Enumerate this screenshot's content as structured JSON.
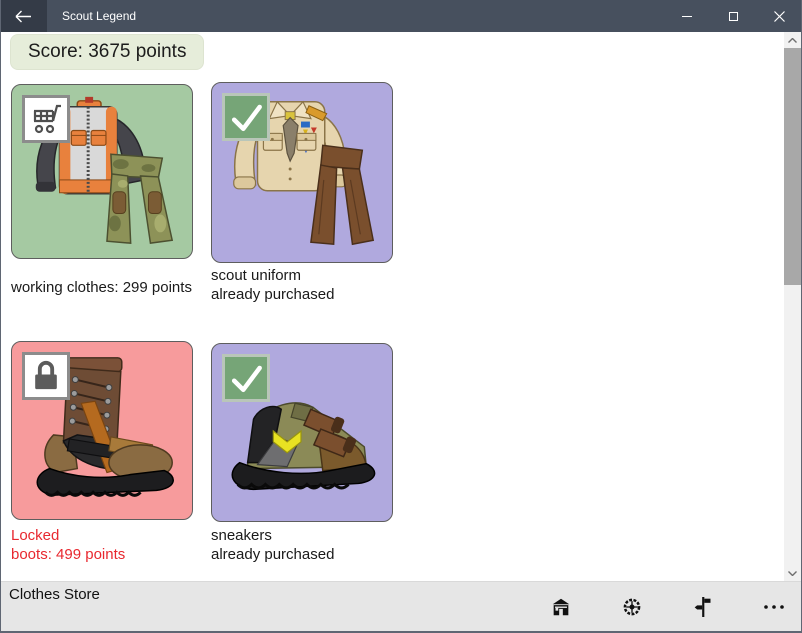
{
  "window": {
    "title": "Scout Legend",
    "icons": {
      "back": "left-arrow",
      "minimize": "minus-line",
      "maximize": "square-outline",
      "close": "x-cross"
    }
  },
  "score": {
    "text": "Score: 3675 points"
  },
  "store": {
    "items": [
      {
        "name": "working clothes",
        "caption1": "working clothes: 299 points",
        "badge": "shopping-cart",
        "status": "available",
        "bg": "#a5c9a2"
      },
      {
        "name": "scout uniform",
        "caption1": "scout uniform",
        "caption2": "already purchased",
        "badge": "checkmark",
        "status": "purchased",
        "bg": "#b0a9de"
      },
      {
        "name": "boots",
        "caption1": "Locked",
        "caption2": "boots: 499 points",
        "badge": "padlock",
        "status": "locked",
        "bg": "#f79b9c"
      },
      {
        "name": "sneakers",
        "caption1": "sneakers",
        "caption2": "already purchased",
        "badge": "checkmark",
        "status": "purchased",
        "bg": "#b0a9de"
      }
    ]
  },
  "bottom_bar": {
    "label": "Clothes Store",
    "icons": [
      "home",
      "wheel",
      "signpost",
      "more"
    ]
  },
  "colors": {
    "titlebar": "#47505e",
    "titlebar_back": "#343b47",
    "score_bg": "#e6edda",
    "check_badge": "#76a577",
    "locked_text": "#e8282f",
    "appbar_bg": "#e6e6e6"
  }
}
